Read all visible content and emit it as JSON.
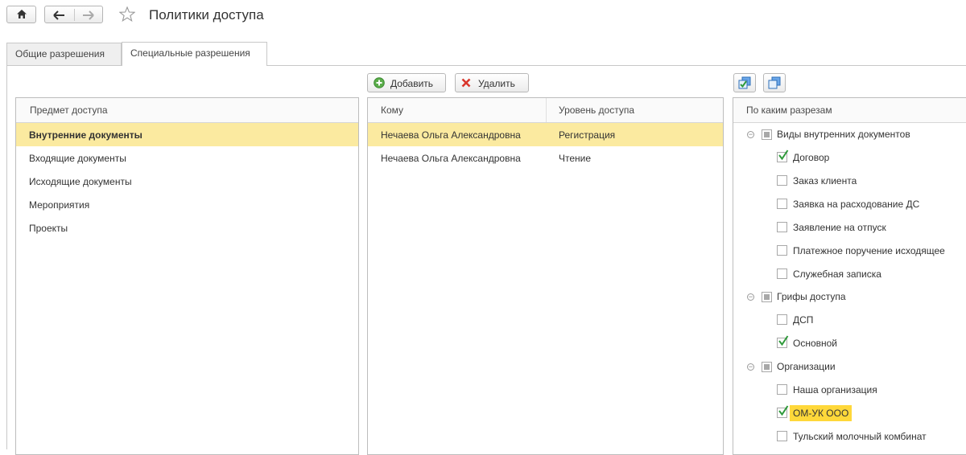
{
  "window": {
    "title": "Политики доступа"
  },
  "nav": {
    "home_icon": "home-icon",
    "back_icon": "arrow-left-icon",
    "forward_icon": "arrow-right-icon",
    "favorite_icon": "star-icon"
  },
  "tabs": [
    {
      "label": "Общие разрешения",
      "active": false
    },
    {
      "label": "Специальные разрешения",
      "active": true
    }
  ],
  "toolbar": {
    "add_label": "Добавить",
    "delete_label": "Удалить"
  },
  "subjects": {
    "header": "Предмет доступа",
    "items": [
      {
        "label": "Внутренние документы",
        "selected": true
      },
      {
        "label": "Входящие документы",
        "selected": false
      },
      {
        "label": "Исходящие документы",
        "selected": false
      },
      {
        "label": "Мероприятия",
        "selected": false
      },
      {
        "label": "Проекты",
        "selected": false
      }
    ]
  },
  "permissions": {
    "columns": [
      "Кому",
      "Уровень доступа"
    ],
    "rows": [
      {
        "who": "Нечаева Ольга Александровна",
        "level": "Регистрация",
        "selected": true
      },
      {
        "who": "Нечаева Ольга Александровна",
        "level": "Чтение",
        "selected": false
      }
    ]
  },
  "dimensions": {
    "header": "По каким разрезам",
    "groups": [
      {
        "label": "Виды внутренних документов",
        "items": [
          {
            "label": "Договор",
            "checked": true
          },
          {
            "label": "Заказ клиента",
            "checked": false
          },
          {
            "label": "Заявка на расходование ДС",
            "checked": false
          },
          {
            "label": "Заявление на отпуск",
            "checked": false
          },
          {
            "label": "Платежное поручение исходящее",
            "checked": false
          },
          {
            "label": "Служебная записка",
            "checked": false
          }
        ]
      },
      {
        "label": "Грифы доступа",
        "items": [
          {
            "label": "ДСП",
            "checked": false
          },
          {
            "label": "Основной",
            "checked": true
          }
        ]
      },
      {
        "label": "Организации",
        "items": [
          {
            "label": "Наша организация",
            "checked": false
          },
          {
            "label": "ОМ-УК ООО",
            "checked": true
          },
          {
            "label": "Тульский молочный комбинат",
            "checked": false
          }
        ]
      }
    ]
  },
  "colors": {
    "selection": "#fbeaa0",
    "highlight": "#ffd83a",
    "check": "#2e9a3a"
  }
}
